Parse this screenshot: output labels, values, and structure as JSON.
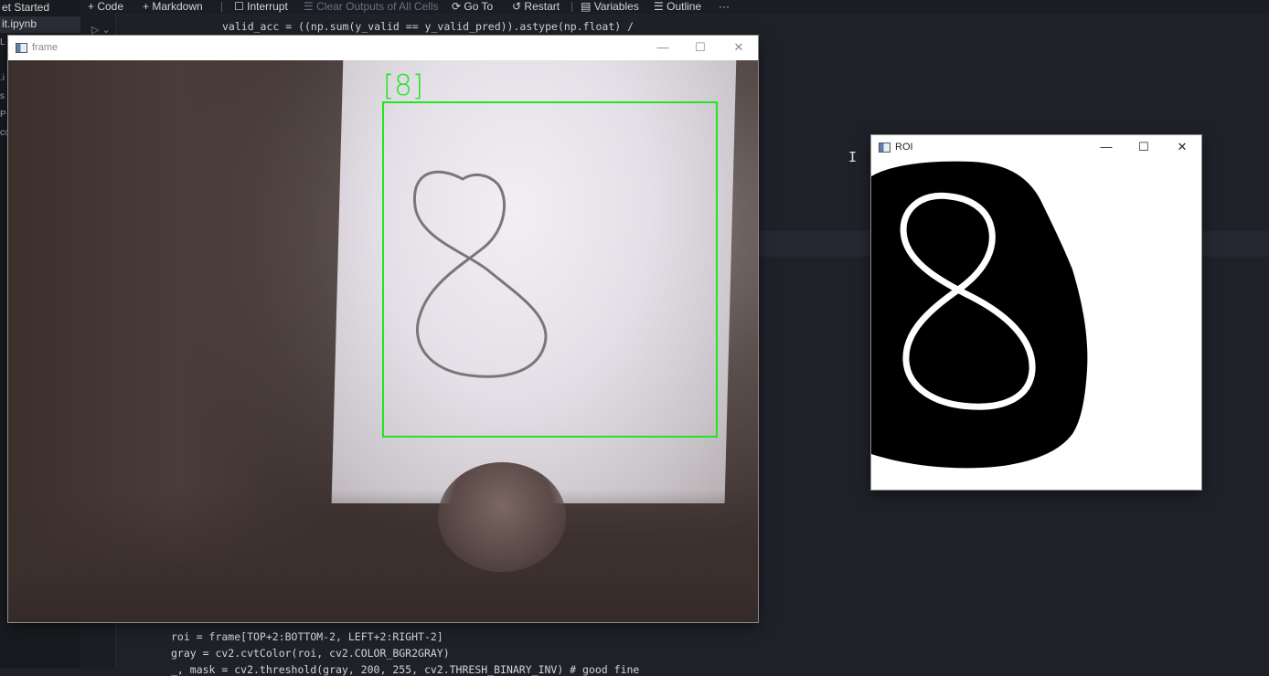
{
  "explorer": {
    "tabs": [
      {
        "label": "et Started",
        "active": false
      },
      {
        "label": "it.ipynb",
        "active": true
      }
    ],
    "truncated_items": [
      "L",
      ".i",
      "s",
      "P",
      "co"
    ]
  },
  "toolbar": {
    "code_label": "Code",
    "markdown_label": "Markdown",
    "interrupt_label": "Interrupt",
    "clear_outputs_label": "Clear Outputs of All Cells",
    "goto_label": "Go To",
    "restart_label": "Restart",
    "variables_label": "Variables",
    "outline_label": "Outline",
    "more_label": "···"
  },
  "code_top": {
    "line": "valid_acc = ((np.sum(y_valid == y_valid_pred)).astype(np.float) /"
  },
  "code_bottom": {
    "line1": "roi = frame[TOP+2:BOTTOM-2, LEFT+2:RIGHT-2]",
    "line2": "gray = cv2.cvtColor(roi, cv2.COLOR_BGR2GRAY)",
    "line3_partial": "_, mask = cv2.threshold(gray, 200, 255, cv2.THRESH_BINARY_INV) # good fine"
  },
  "frame_window": {
    "title": "frame",
    "prediction_label": "[8]",
    "bbox_color": "#20e620",
    "minimize": "—",
    "maximize": "☐",
    "close": "✕"
  },
  "roi_window": {
    "title": "ROI",
    "minimize": "—",
    "maximize": "☐",
    "close": "✕"
  },
  "icons": {
    "app_window_icon": "window-icon",
    "run_cell_icon": "run-chevron-icon",
    "text_cursor_icon": "i-beam-icon"
  }
}
